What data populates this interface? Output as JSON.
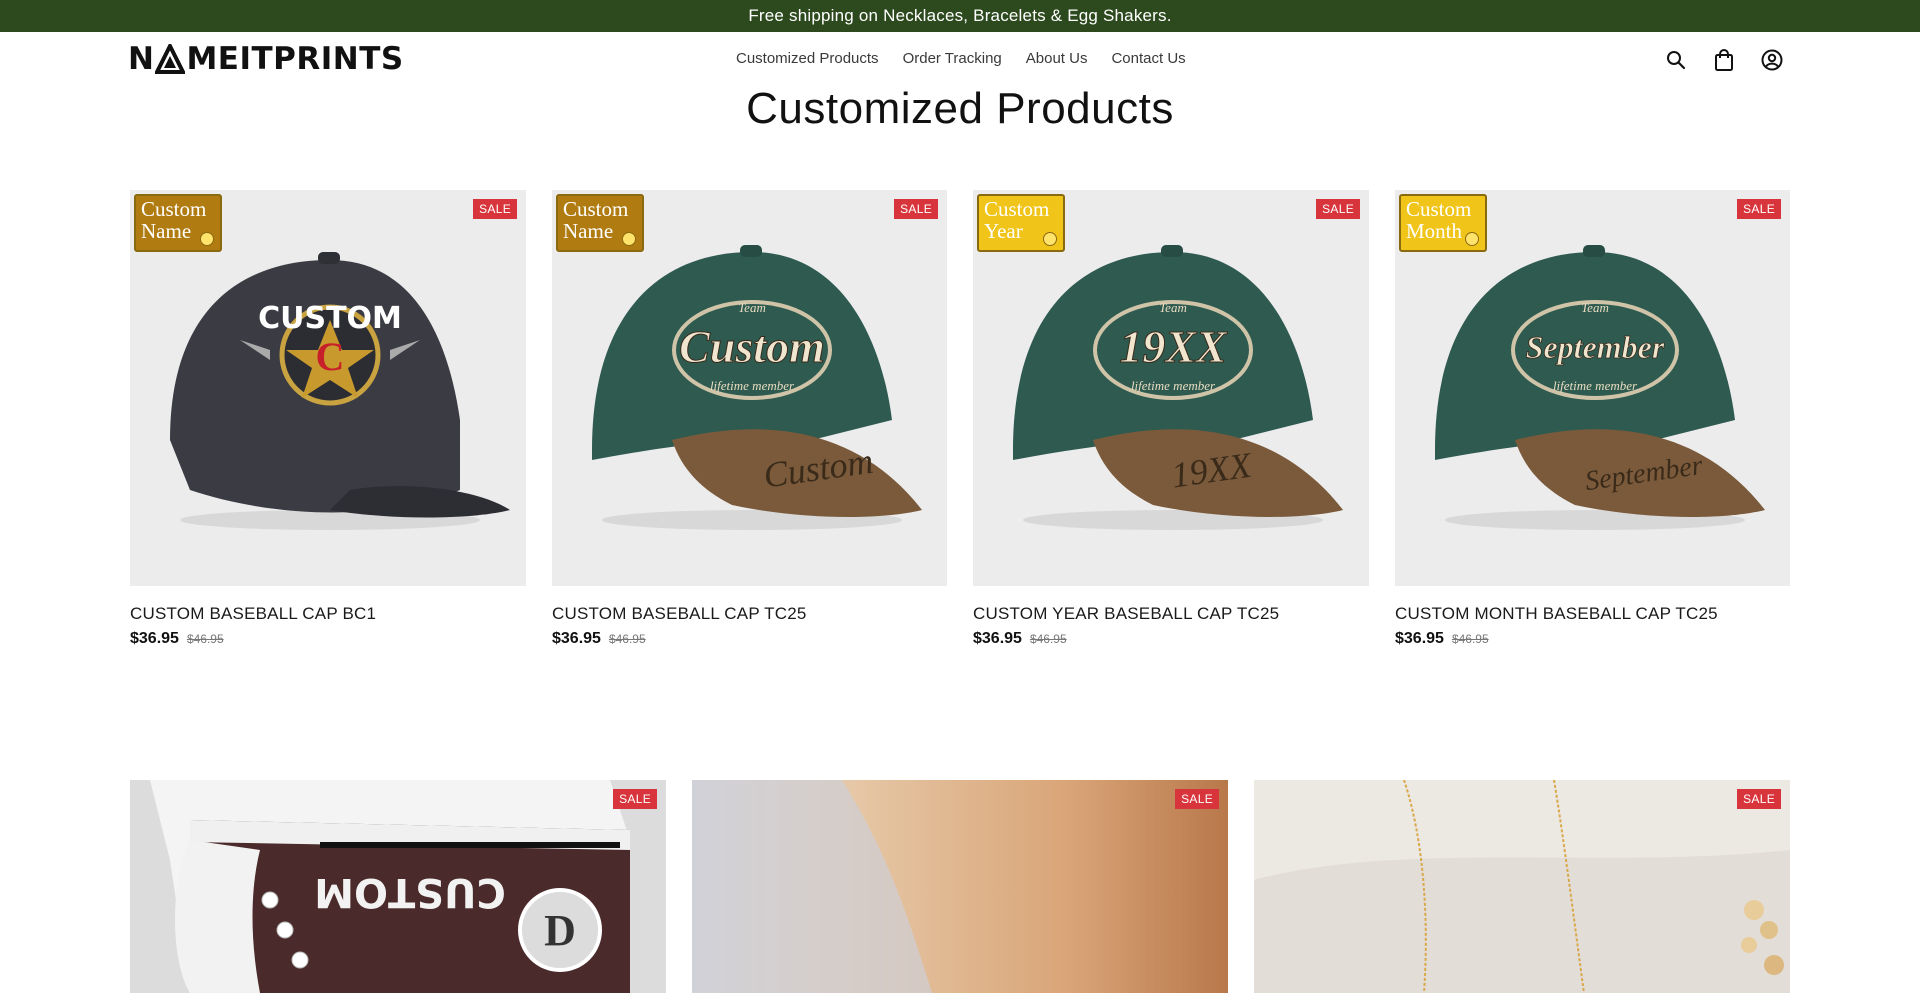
{
  "announcement": "Free shipping on Necklaces, Bracelets & Egg Shakers.",
  "logo": {
    "left": "N",
    "right": "MEITPRINTS"
  },
  "nav": [
    "Customized Products",
    "Order Tracking",
    "About Us",
    "Contact Us"
  ],
  "header_icons": [
    "search-icon",
    "bag-icon",
    "account-icon"
  ],
  "page_title": "Customized Products",
  "sale_label": "SALE",
  "products": [
    {
      "name": "CUSTOM BASEBALL CAP BC1",
      "price": "$36.95",
      "old_price": "$46.95",
      "badge": [
        "Custom",
        "Name"
      ],
      "cap_text": "CUSTOM"
    },
    {
      "name": "CUSTOM BASEBALL CAP TC25",
      "price": "$36.95",
      "old_price": "$46.95",
      "badge": [
        "Custom",
        "Name"
      ],
      "cap_text": "Custom",
      "cap_sub": "lifetime member",
      "cap_team": "Team",
      "visor_text": "Custom"
    },
    {
      "name": "CUSTOM YEAR BASEBALL CAP TC25",
      "price": "$36.95",
      "old_price": "$46.95",
      "badge": [
        "Custom",
        "Year"
      ],
      "cap_text": "19XX",
      "cap_sub": "lifetime member",
      "cap_team": "Team",
      "visor_text": "19XX"
    },
    {
      "name": "CUSTOM MONTH BASEBALL CAP TC25",
      "price": "$36.95",
      "old_price": "$46.95",
      "badge": [
        "Custom",
        "Month"
      ],
      "cap_text": "September",
      "cap_sub": "lifetime member",
      "cap_team": "Team",
      "visor_text": "September"
    }
  ],
  "row2": [
    {
      "shoe_text": "CUSTOM"
    },
    {},
    {}
  ],
  "colors": {
    "announce_bg": "#2d4a1e",
    "sale_bg": "#d8343c",
    "cap_green": "#2e5a50",
    "cap_brown": "#7a5a3a",
    "cap_charcoal": "#3b3b44"
  }
}
